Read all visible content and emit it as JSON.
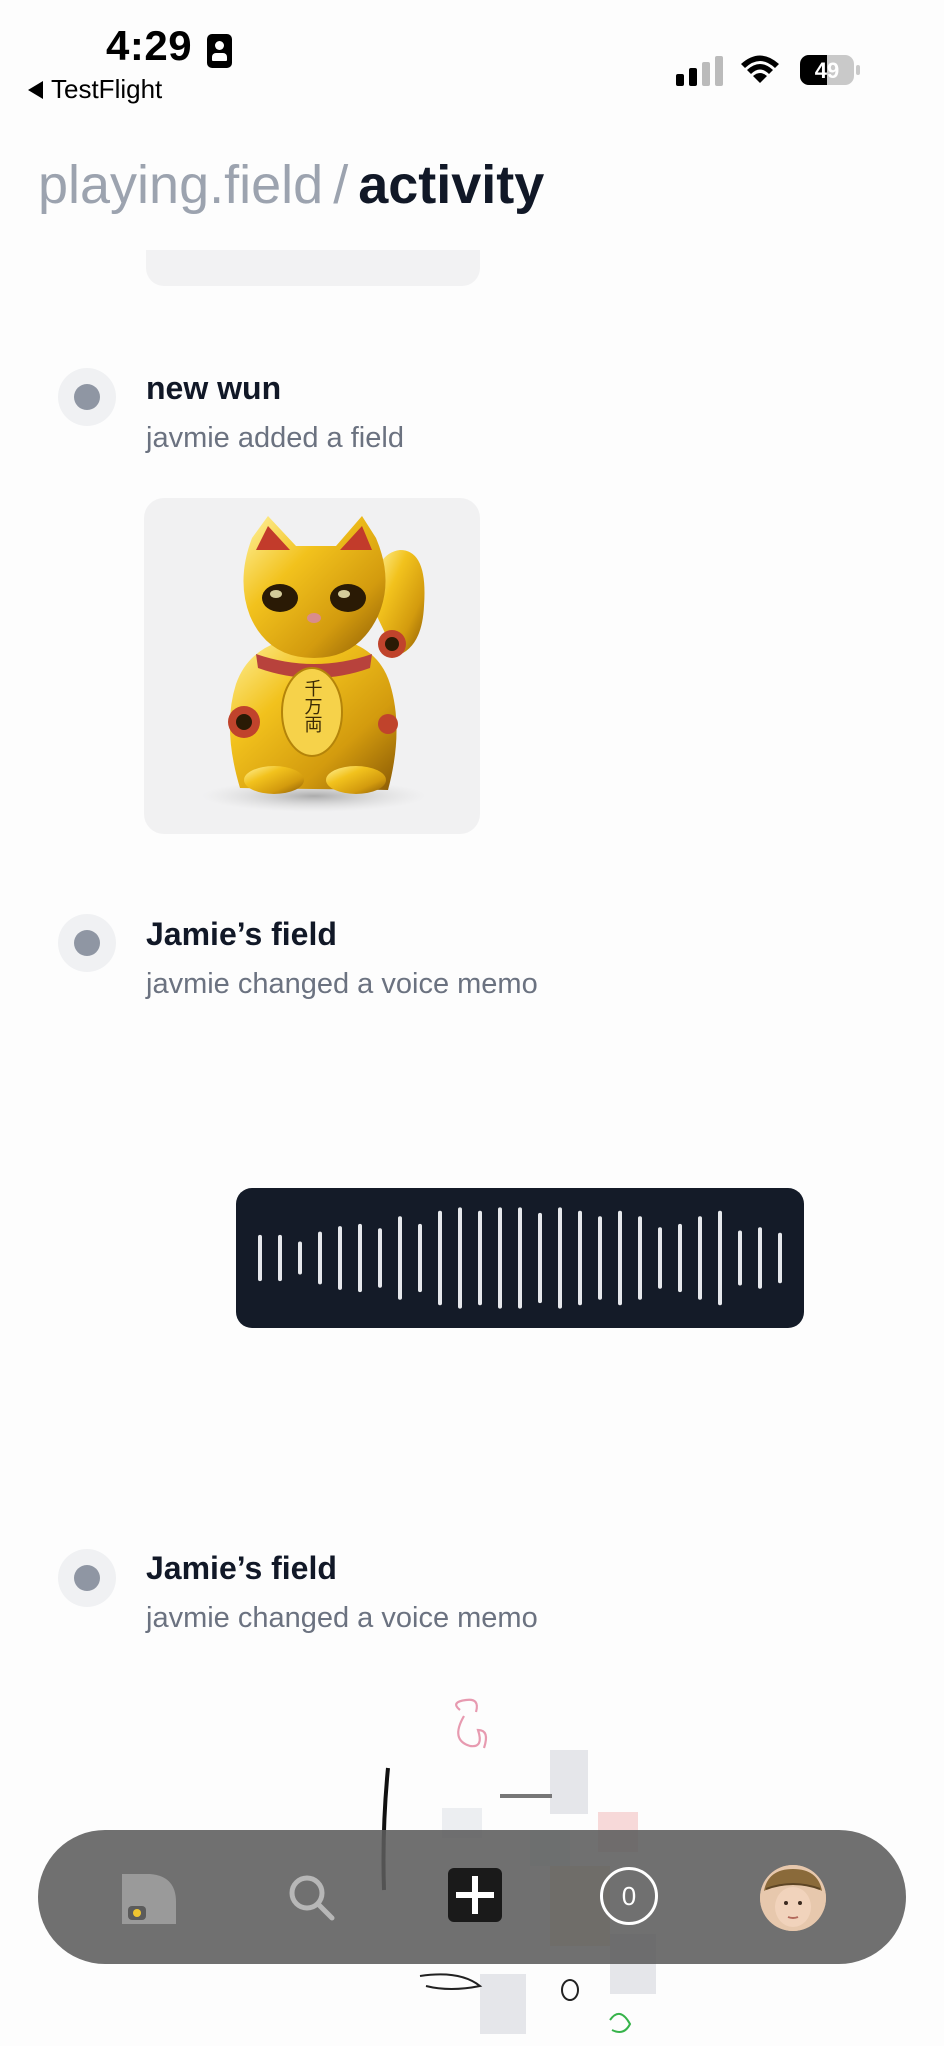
{
  "status_bar": {
    "time": "4:29",
    "back_app": "TestFlight",
    "battery": "49"
  },
  "header": {
    "crumb": "playing.field",
    "separator": "/",
    "current": "activity"
  },
  "feed": [
    {
      "title": "new wun",
      "subtitle": "javmie added a field",
      "media": "lucky-cat-image"
    },
    {
      "title": "Jamie’s field",
      "subtitle": "javmie changed a voice memo",
      "media": "voice-memo-waveform"
    },
    {
      "title": "Jamie’s field",
      "subtitle": "javmie changed a voice memo",
      "media": "canvas-sketch"
    }
  ],
  "voice_memo": {
    "bar_levels": [
      0.42,
      0.42,
      0.3,
      0.48,
      0.58,
      0.62,
      0.54,
      0.76,
      0.62,
      0.86,
      0.92,
      0.86,
      0.92,
      0.92,
      0.82,
      0.92,
      0.86,
      0.76,
      0.86,
      0.76,
      0.56,
      0.62,
      0.76,
      0.86,
      0.5,
      0.56,
      0.46
    ]
  },
  "cat": {
    "coin_text": "千万両"
  },
  "nav": {
    "items": [
      {
        "name": "home-tab-icon"
      },
      {
        "name": "search-icon"
      },
      {
        "name": "add-icon"
      },
      {
        "name": "notifications-count"
      },
      {
        "name": "profile-avatar"
      }
    ],
    "count": "0"
  },
  "colors": {
    "background": "#fdfdfd",
    "title": "#111827",
    "muted": "#9ca3af",
    "subtitle": "#6b7280",
    "voice_card": "#141b28",
    "nav_bar": "#5c5c5c",
    "gold": "#e8b41c"
  }
}
